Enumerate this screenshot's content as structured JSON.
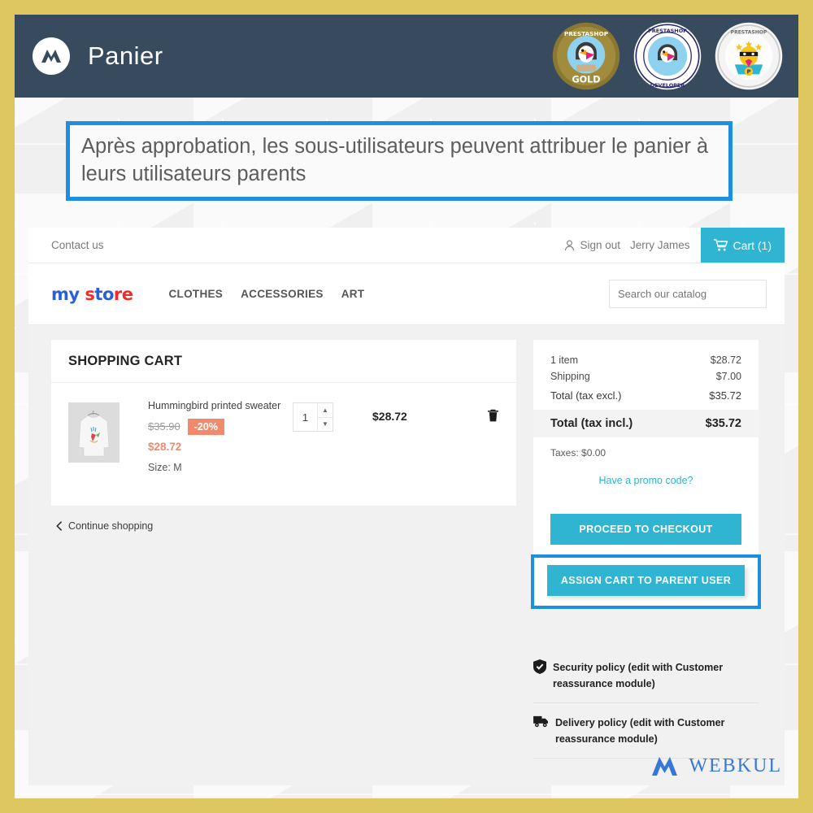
{
  "frame": {
    "border_color": "#dec760"
  },
  "header": {
    "title": "Panier",
    "logo_icon": "webkul-logo-icon",
    "badges": [
      {
        "name": "prestashop-partner-gold-badge",
        "label": "PRESTASHOP PARTNER",
        "sub": "GOLD"
      },
      {
        "name": "prestashop-module-developer-badge",
        "label": "PRESTASHOP PARTNER",
        "sub": "MODULE DEVELOPER"
      },
      {
        "name": "prestashop-super-hero-seller-badge",
        "label": "PRESTASHOP",
        "sub": "SUPER HERO SELLER"
      }
    ]
  },
  "caption": {
    "text": "Après approbation, les sous-utilisateurs peuvent attribuer le panier à leurs utilisateurs parents",
    "border_color": "#1e8ee0"
  },
  "nav": {
    "contact": "Contact us",
    "sign_out": "Sign out",
    "user": "Jerry James",
    "cart_label": "Cart (1)",
    "cart_color": "#2fb5d2"
  },
  "store": {
    "logo_parts": [
      {
        "t": "m",
        "c": "b"
      },
      {
        "t": "y",
        "c": "b"
      },
      {
        "t": " ",
        "c": "b"
      },
      {
        "t": "s",
        "c": "r"
      },
      {
        "t": "t",
        "c": "b"
      },
      {
        "t": "o",
        "c": "b"
      },
      {
        "t": "r",
        "c": "r"
      },
      {
        "t": "e",
        "c": "r"
      }
    ],
    "menu": [
      "CLOTHES",
      "ACCESSORIES",
      "ART"
    ],
    "search_placeholder": "Search our catalog"
  },
  "cart": {
    "title": "SHOPPING CART",
    "item": {
      "name": "Hummingbird printed sweater",
      "old_price": "$35.90",
      "discount": "-20%",
      "new_price": "$28.72",
      "size": "Size: M",
      "qty": "1",
      "line_total": "$28.72",
      "delete_icon": "trash-icon"
    },
    "continue": "Continue shopping"
  },
  "summary": {
    "rows": [
      {
        "label": "1 item",
        "value": "$28.72"
      },
      {
        "label": "Shipping",
        "value": "$7.00"
      }
    ],
    "total_excl_label": "Total (tax excl.)",
    "total_excl_value": "$35.72",
    "total_incl_label": "Total (tax incl.)",
    "total_incl_value": "$35.72",
    "taxes": "Taxes: $0.00",
    "promo": "Have a promo code?",
    "checkout_btn": "PROCEED TO CHECKOUT",
    "assign_btn": "ASSIGN CART TO PARENT USER"
  },
  "reassurance": [
    {
      "icon": "shield-check-icon",
      "text": "Security policy (edit with Customer reassurance module)"
    },
    {
      "icon": "truck-icon",
      "text": "Delivery policy (edit with Customer reassurance module)"
    }
  ],
  "watermark": {
    "text": "WEBKUL",
    "icon": "webkul-mark-icon",
    "color": "#2a6fd6"
  }
}
